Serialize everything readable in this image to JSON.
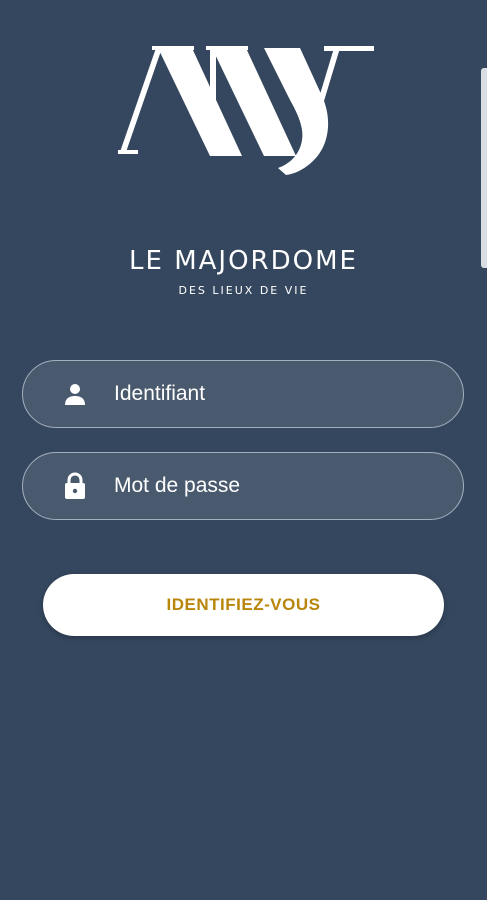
{
  "brand": {
    "title": "LE MAJORDOME",
    "subtitle": "DES LIEUX DE VIE",
    "logo_icon": "mv-monogram-logo"
  },
  "login": {
    "username_placeholder": "Identifiant",
    "username_value": "",
    "username_icon": "user-icon",
    "password_placeholder": "Mot de passe",
    "password_value": "",
    "password_icon": "lock-icon",
    "submit_label": "IDENTIFIEZ-VOUS"
  },
  "colors": {
    "background": "#35475e",
    "field_background": "#4a5a6e",
    "field_border": "#a4afbd",
    "button_text": "#b8860b",
    "button_background": "#ffffff"
  }
}
